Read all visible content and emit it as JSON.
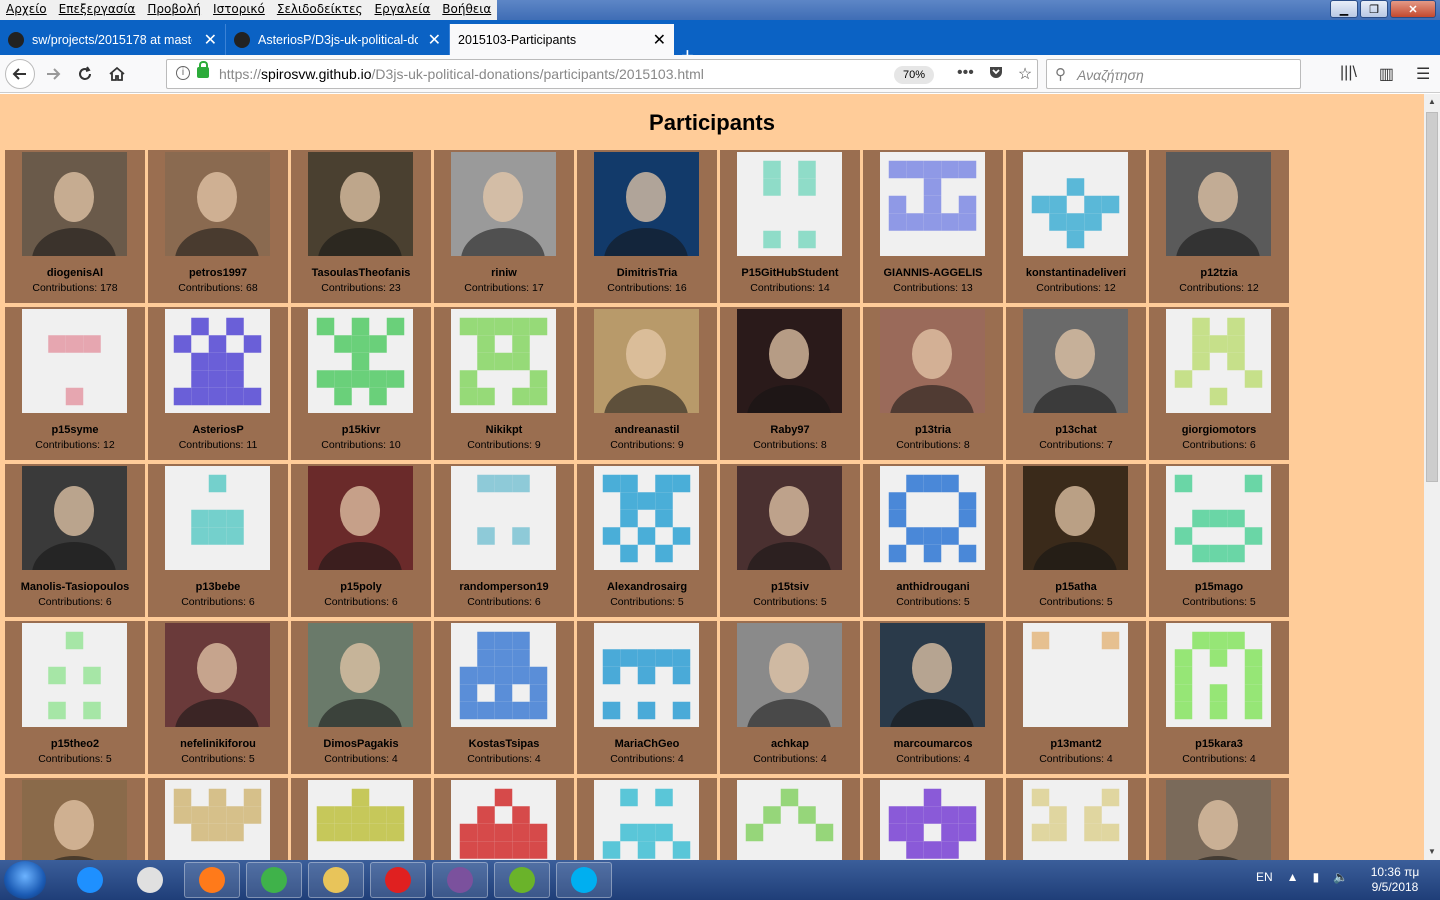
{
  "menu": [
    "Αρχείο",
    "Επεξεργασία",
    "Προβολή",
    "Ιστορικό",
    "Σελιδοδείκτες",
    "Εργαλεία",
    "Βοήθεια"
  ],
  "tabs": [
    {
      "label": "sw/projects/2015178 at master",
      "active": false
    },
    {
      "label": "AsteriosP/D3js-uk-political-do",
      "active": false
    },
    {
      "label": "2015103-Participants",
      "active": true
    }
  ],
  "nav": {
    "url_prefix": "https://",
    "url_host": "spirosvw.github.io",
    "url_path": "/D3js-uk-political-donations/participants/2015103.html",
    "zoom": "70%",
    "search_placeholder": "Αναζήτηση"
  },
  "page": {
    "title": "Participants",
    "contrib_prefix": "Contributions: ",
    "participants": [
      {
        "name": "diogenisAl",
        "count": 178,
        "avatar": "photo",
        "color": "#6a5a4a"
      },
      {
        "name": "petros1997",
        "count": 68,
        "avatar": "photo",
        "color": "#8a6a50"
      },
      {
        "name": "TasoulasTheofanis",
        "count": 23,
        "avatar": "photo",
        "color": "#4a4030"
      },
      {
        "name": "riniw",
        "count": 17,
        "avatar": "photo",
        "color": "#9a9a9a"
      },
      {
        "name": "DimitrisTria",
        "count": 16,
        "avatar": "photo",
        "color": "#123a6a"
      },
      {
        "name": "P15GitHubStudent",
        "count": 14,
        "avatar": "identicon",
        "color": "#8fdcc8",
        "pattern": "01010,01010,00000,00000,01010"
      },
      {
        "name": "GIANNIS-AGGELIS",
        "count": 13,
        "avatar": "identicon",
        "color": "#8f99e6",
        "pattern": "11111,00100,10101,11111,00000"
      },
      {
        "name": "konstantinadeliveri",
        "count": 12,
        "avatar": "identicon",
        "color": "#5ab8d8",
        "pattern": "00000,00100,11011,01110,00100"
      },
      {
        "name": "p12tzia",
        "count": 12,
        "avatar": "photo",
        "color": "#5a5a5a"
      },
      {
        "name": "p15syme",
        "count": 12,
        "avatar": "identicon",
        "color": "#e6a6b0",
        "pattern": "00000,01110,00000,00000,00100"
      },
      {
        "name": "AsteriosP",
        "count": 11,
        "avatar": "identicon",
        "color": "#6a5fd8",
        "pattern": "01010,10101,01110,01110,11111"
      },
      {
        "name": "p15kivr",
        "count": 10,
        "avatar": "identicon",
        "color": "#6ad07a",
        "pattern": "10101,01110,00100,11111,01010"
      },
      {
        "name": "Nikikpt",
        "count": 9,
        "avatar": "identicon",
        "color": "#96da78",
        "pattern": "11111,01010,01110,10001,11011"
      },
      {
        "name": "andreanastil",
        "count": 9,
        "avatar": "photo",
        "color": "#b89a6a"
      },
      {
        "name": "Raby97",
        "count": 8,
        "avatar": "photo",
        "color": "#2a1a1a"
      },
      {
        "name": "p13tria",
        "count": 8,
        "avatar": "photo",
        "color": "#9a6a5a"
      },
      {
        "name": "p13chat",
        "count": 7,
        "avatar": "photo",
        "color": "#6a6a6a"
      },
      {
        "name": "giorgiomotors",
        "count": 6,
        "avatar": "identicon",
        "color": "#c6e08a",
        "pattern": "01010,01110,01010,10001,00100"
      },
      {
        "name": "Manolis-Tasiopoulos",
        "count": 6,
        "avatar": "photo",
        "color": "#3a3a3a"
      },
      {
        "name": "p13bebe",
        "count": 6,
        "avatar": "identicon",
        "color": "#74d0cc",
        "pattern": "00100,00000,01110,01110,00000"
      },
      {
        "name": "p15poly",
        "count": 6,
        "avatar": "photo",
        "color": "#6a2a2a"
      },
      {
        "name": "randomperson19",
        "count": 6,
        "avatar": "identicon",
        "color": "#8ecad8",
        "pattern": "01110,00000,00000,01010,00000"
      },
      {
        "name": "Alexandrosairg",
        "count": 5,
        "avatar": "identicon",
        "color": "#4aaed8",
        "pattern": "11011,01110,01010,10101,01010"
      },
      {
        "name": "p15tsiv",
        "count": 5,
        "avatar": "photo",
        "color": "#4a3030"
      },
      {
        "name": "anthidrougani",
        "count": 5,
        "avatar": "identicon",
        "color": "#4a88d8",
        "pattern": "01110,10001,10001,01110,10101"
      },
      {
        "name": "p15atha",
        "count": 5,
        "avatar": "photo",
        "color": "#3a2a1a"
      },
      {
        "name": "p15mago",
        "count": 5,
        "avatar": "identicon",
        "color": "#6ad6a6",
        "pattern": "10001,00000,01110,10001,01110"
      },
      {
        "name": "p15theo2",
        "count": 5,
        "avatar": "identicon",
        "color": "#a6e6a6",
        "pattern": "00100,00000,01010,00000,01010"
      },
      {
        "name": "nefelinikiforou",
        "count": 5,
        "avatar": "photo",
        "color": "#6a3a3a"
      },
      {
        "name": "DimosPagakis",
        "count": 4,
        "avatar": "photo",
        "color": "#6a7a6a"
      },
      {
        "name": "KostasTsipas",
        "count": 4,
        "avatar": "identicon",
        "color": "#5a8ed8",
        "pattern": "01110,01110,11111,10101,11111"
      },
      {
        "name": "MariaChGeo",
        "count": 4,
        "avatar": "identicon",
        "color": "#4aaad8",
        "pattern": "00000,11111,10101,00000,10101"
      },
      {
        "name": "achkap",
        "count": 4,
        "avatar": "photo",
        "color": "#8a8a8a"
      },
      {
        "name": "marcoumarcos",
        "count": 4,
        "avatar": "photo",
        "color": "#2a3a4a"
      },
      {
        "name": "p13mant2",
        "count": 4,
        "avatar": "identicon",
        "color": "#e6c090",
        "pattern": "10001,00000,00000,00000,00000"
      },
      {
        "name": "p15kara3",
        "count": 4,
        "avatar": "identicon",
        "color": "#96e676",
        "pattern": "01110,10101,10001,10101,10101"
      },
      {
        "name": "",
        "count": null,
        "avatar": "photo",
        "color": "#8a6a4a"
      },
      {
        "name": "",
        "count": null,
        "avatar": "identicon",
        "color": "#d6c08a",
        "pattern": "10101,11111,01110,00000,00000"
      },
      {
        "name": "",
        "count": null,
        "avatar": "identicon",
        "color": "#c6c85a",
        "pattern": "00100,11111,11111,00000,00000"
      },
      {
        "name": "",
        "count": null,
        "avatar": "identicon",
        "color": "#d64a4a",
        "pattern": "00100,01010,11111,11111,00000"
      },
      {
        "name": "",
        "count": null,
        "avatar": "identicon",
        "color": "#5ac6d8",
        "pattern": "01010,00000,01110,10101,00000"
      },
      {
        "name": "",
        "count": null,
        "avatar": "identicon",
        "color": "#96d67a",
        "pattern": "00100,01010,10001,00000,00000"
      },
      {
        "name": "",
        "count": null,
        "avatar": "identicon",
        "color": "#8a5ad8",
        "pattern": "00100,11111,11011,01110,00000"
      },
      {
        "name": "",
        "count": null,
        "avatar": "identicon",
        "color": "#e0d6a0",
        "pattern": "10001,01010,11011,00000,00000"
      },
      {
        "name": "",
        "count": null,
        "avatar": "photo",
        "color": "#7a6a5a"
      }
    ]
  },
  "taskbar": {
    "lang": "EN",
    "time": "10:36 πμ",
    "date": "9/5/2018",
    "apps": [
      {
        "name": "ie",
        "color": "#1e90ff"
      },
      {
        "name": "media",
        "color": "#e0e0e0"
      },
      {
        "name": "firefox",
        "color": "#ff7a1a"
      },
      {
        "name": "chrome",
        "color": "#3fb24a"
      },
      {
        "name": "explorer",
        "color": "#e8c45a"
      },
      {
        "name": "mp3",
        "color": "#e02020"
      },
      {
        "name": "viber",
        "color": "#7b519d"
      },
      {
        "name": "utorrent",
        "color": "#6ab32a"
      },
      {
        "name": "skype",
        "color": "#00aff0"
      }
    ]
  }
}
